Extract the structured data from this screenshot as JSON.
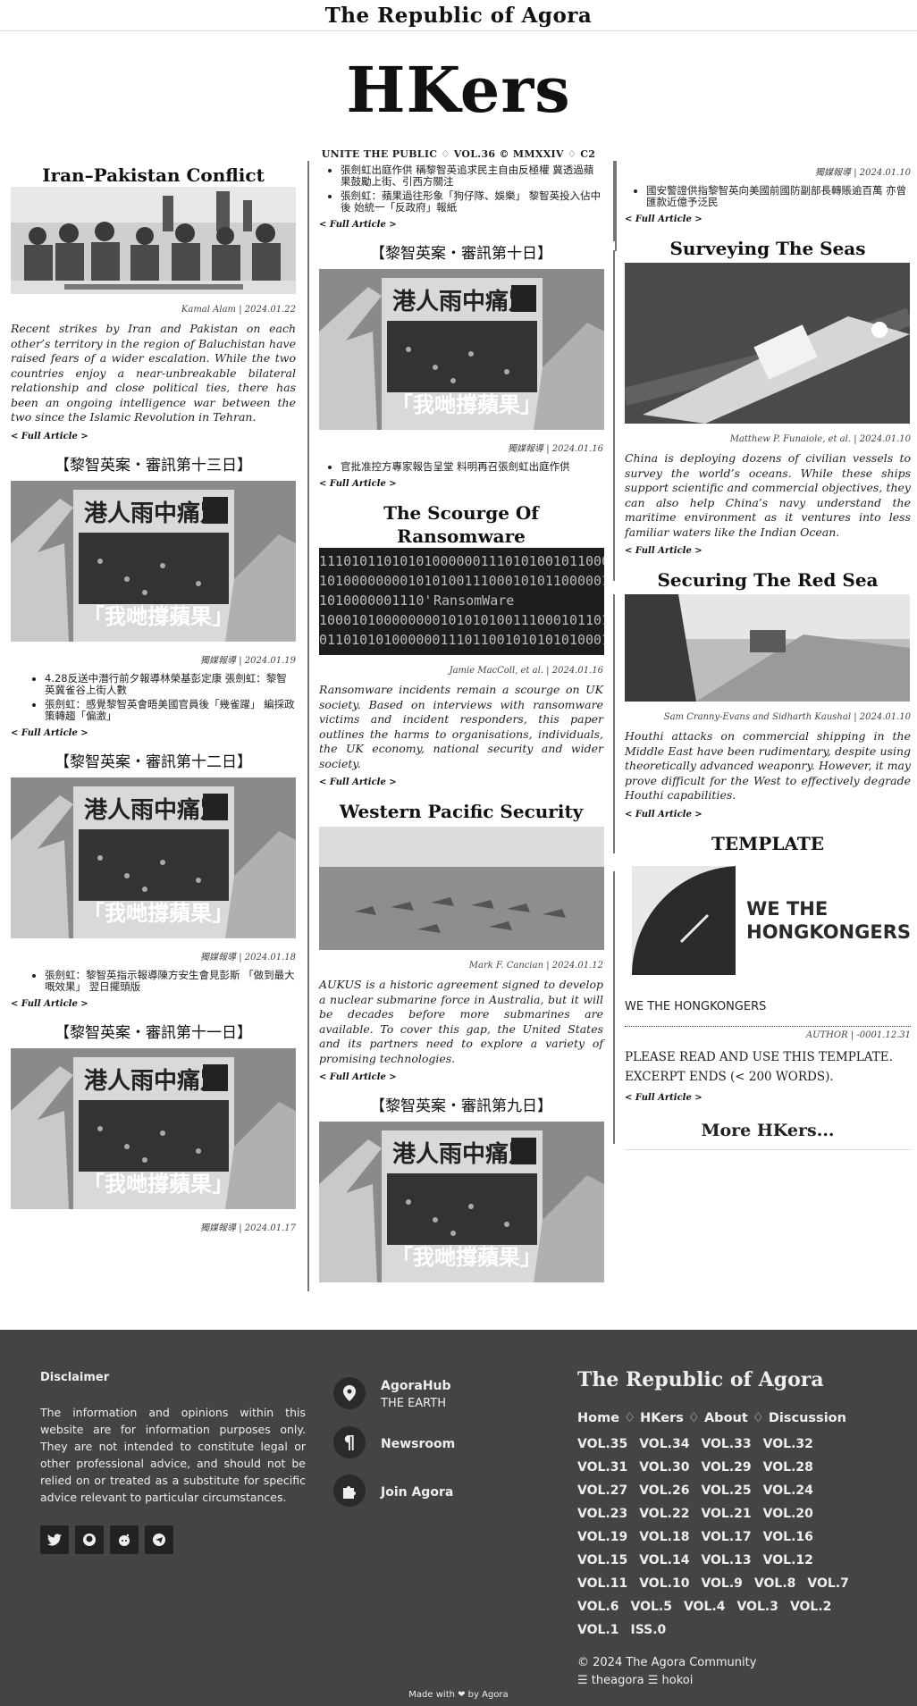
{
  "site": {
    "brand": "The Republic of Agora",
    "masthead": "HKers",
    "tagline": "UNITE THE PUBLIC ♢ VOL.36 © MMXXIV ♢ C2"
  },
  "col1": {
    "a1": {
      "title": "Iran–Pakistan Conflict",
      "meta": "Kamal Alam | 2024.01.22",
      "excerpt": "Recent strikes by Iran and Pakistan on each other’s territory in the region of Baluchistan have raised fears of a wider escalation. While the two countries enjoy a near-unbreakable bilateral relationship and close political ties, there has been an ongoing intelligence war between the two since the Islamic Revolution in Tehran.",
      "more": "< Full Article >"
    },
    "a2": {
      "title": "【黎智英案・審訊第十三日】",
      "meta": "獨媒報導 | 2024.01.19",
      "items": [
        "4.28反送中潛行前夕報導林榮基彭定康 張劍虹：黎智英冀雀谷上街人數",
        "張劍虹：感覺黎智英會晤美國官員後「幾雀躍」 編採政策轉趨「偏激」"
      ],
      "more": "< Full Article >"
    },
    "a3": {
      "title": "【黎智英案・審訊第十二日】",
      "meta": "獨媒報導 | 2024.01.18",
      "items": [
        "張劍虹：黎智英指示報導陳方安生會見彭斯 「做到最大嘅效果」 翌日擺頭版"
      ],
      "more": "< Full Article >"
    },
    "a4": {
      "title": "【黎智英案・審訊第十一日】",
      "meta": "獨媒報導 | 2024.01.17"
    }
  },
  "col2": {
    "a0": {
      "items": [
        "張劍虹出庭作供 稱黎智英追求民主自由反極權 冀透過蘋果鼓勵上街、引西方關注",
        "張劍虹：蘋果過往形象「狗仔隊、娛樂」 黎智英投入佔中後 始統一「反政府」報紙"
      ],
      "more": "< Full Article >"
    },
    "a1": {
      "title": "【黎智英案・審訊第十日】",
      "meta": "獨媒報導 | 2024.01.16",
      "items": [
        "官批准控方專家報告呈堂 料明再召張劍虹出庭作供"
      ],
      "more": "< Full Article >"
    },
    "a2": {
      "title": "The Scourge Of Ransomware",
      "meta": "Jamie MacColl, et al. | 2024.01.16",
      "excerpt": "Ransomware incidents remain a scourge on UK society. Based on interviews with ransomware victims and incident responders, this paper outlines the harms to organisations, individuals, the UK economy, national security and wider society.",
      "more": "< Full Article >",
      "img_text": "RansomWare"
    },
    "a3": {
      "title": "Western Pacific Security",
      "meta": "Mark F. Cancian | 2024.01.12",
      "excerpt": "AUKUS is a historic agreement signed to develop a nuclear submarine force in Australia, but it will be decades before more submarines are available. To cover this gap, the United States and its partners need to explore a variety of promising technologies.",
      "more": "< Full Article >"
    },
    "a4": {
      "title": "【黎智英案・審訊第九日】"
    }
  },
  "col3": {
    "a0": {
      "meta": "獨媒報導 | 2024.01.10",
      "items": [
        "國安警證供指黎智英向美國前國防副部長轉賬逾百萬 亦曾匯款近億予泛民"
      ],
      "more": "< Full Article >"
    },
    "a1": {
      "title": "Surveying The Seas",
      "meta": "Matthew P. Funaiole, et al. | 2024.01.10",
      "excerpt": "China is deploying dozens of civilian vessels to survey the world’s oceans. While these ships support scientific and commercial objectives, they can also help China’s navy understand the maritime environment as it ventures into less familiar waters like the Indian Ocean.",
      "more": "< Full Article >"
    },
    "a2": {
      "title": "Securing The Red Sea",
      "meta": "Sam Cranny-Evans and Sidharth Kaushal | 2024.01.10",
      "excerpt": "Houthi attacks on commercial shipping in the Middle East have been rudimentary, despite using theoretically advanced weaponry. However, it may prove difficult for the West to effectively degrade Houthi capabilities.",
      "more": "< Full Article >"
    },
    "a3": {
      "title": "TEMPLATE",
      "logo_line1": "WE THE",
      "logo_line2": "HONGKONGERS",
      "caption": "WE THE HONGKONGERS",
      "meta": "AUTHOR | -0001.12.31",
      "body": "PLEASE READ AND USE THIS TEMPLATE. EXCERPT ENDS (< 200 WORDS).",
      "more": "< Full Article >"
    },
    "more_hkers": "More HKers..."
  },
  "newspaper": {
    "headline": "港人雨中痛別",
    "sub": "「我哋撐蘋果」"
  },
  "footer": {
    "disclaimer_title": "Disclaimer",
    "disclaimer": "The information and opinions within this website are for information purposes only. They are not intended to constitute legal or other professional advice, and should not be relied on or treated as a substitute for specific advice relevant to particular circumstances.",
    "links": [
      {
        "label": "AgoraHub",
        "sub": "THE EARTH"
      },
      {
        "label": "Newsroom",
        "sub": ""
      },
      {
        "label": "Join Agora",
        "sub": ""
      }
    ],
    "brand": "The Republic of Agora",
    "nav": "Home ♢ HKers ♢ About ♢ Discussion",
    "vols": [
      "VOL.35",
      "VOL.34",
      "VOL.33",
      "VOL.32",
      "VOL.31",
      "VOL.30",
      "VOL.29",
      "VOL.28",
      "VOL.27",
      "VOL.26",
      "VOL.25",
      "VOL.24",
      "VOL.23",
      "VOL.22",
      "VOL.21",
      "VOL.20",
      "VOL.19",
      "VOL.18",
      "VOL.17",
      "VOL.16",
      "VOL.15",
      "VOL.14",
      "VOL.13",
      "VOL.12",
      "VOL.11",
      "VOL.10",
      "VOL.9",
      "VOL.8",
      "VOL.7",
      "VOL.6",
      "VOL.5",
      "VOL.4",
      "VOL.3",
      "VOL.2",
      "VOL.1",
      "ISS.0"
    ],
    "copyright": "© 2024 The Agora Community",
    "handles": "☰ theagora ☰ hokoi",
    "made_with": "Made with ❤ by Agora"
  }
}
